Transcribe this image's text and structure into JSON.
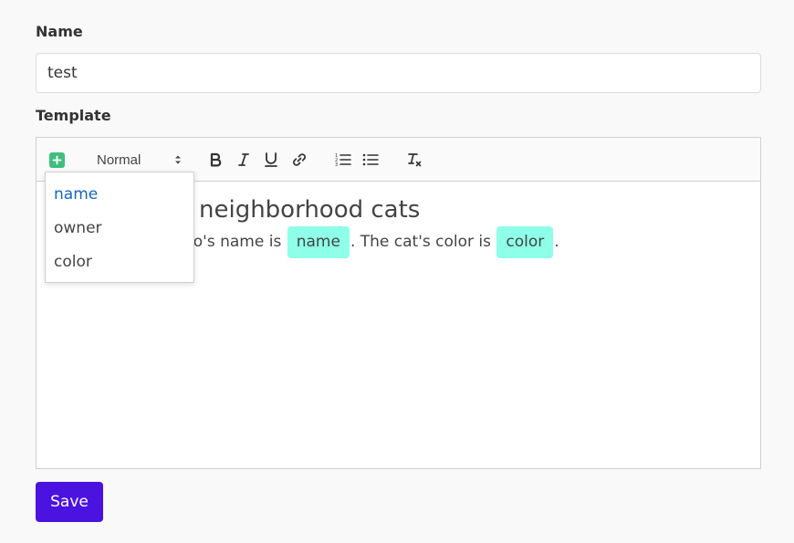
{
  "form": {
    "name_label": "Name",
    "name_value": "test",
    "template_label": "Template"
  },
  "toolbar": {
    "header_select_value": "Normal",
    "buttons": [
      "add-variable",
      "bold",
      "italic",
      "underline",
      "link",
      "ordered-list",
      "bullet-list",
      "clear-format"
    ]
  },
  "editor": {
    "heading_visible": "neighborhood cats",
    "paragraph": {
      "prefix_visible": "ho's name is ",
      "chip1": "name",
      "middle": ". The cat's color is ",
      "chip2": "color",
      "suffix": "."
    }
  },
  "dropdown": {
    "items": [
      {
        "label": "name",
        "active": true
      },
      {
        "label": "owner",
        "active": false
      },
      {
        "label": "color",
        "active": false
      }
    ]
  },
  "actions": {
    "save_label": "Save"
  },
  "colors": {
    "accent": "#4b13e0",
    "chip": "#8effe8",
    "plus_button": "#3fbf7f",
    "dropdown_active": "#1565c0"
  }
}
